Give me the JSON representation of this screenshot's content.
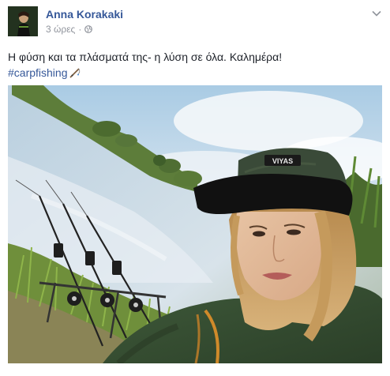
{
  "post": {
    "author": "Anna Korakaki",
    "time": "3 ώρες",
    "separator": "·",
    "text": "Η φύση και τα πλάσματά της- η λύση σε όλα. Καλημέρα!",
    "hashtag": "#carpfishing",
    "emoji_icon": "fishing-rod-icon",
    "photo_icon": "fishing-selfie-photo",
    "menu_icon": "chevron-down-icon",
    "privacy_icon": "globe-icon",
    "cap_label": "VIYAS"
  },
  "colors": {
    "link": "#365899",
    "text": "#1d2129",
    "meta": "#90949c"
  }
}
